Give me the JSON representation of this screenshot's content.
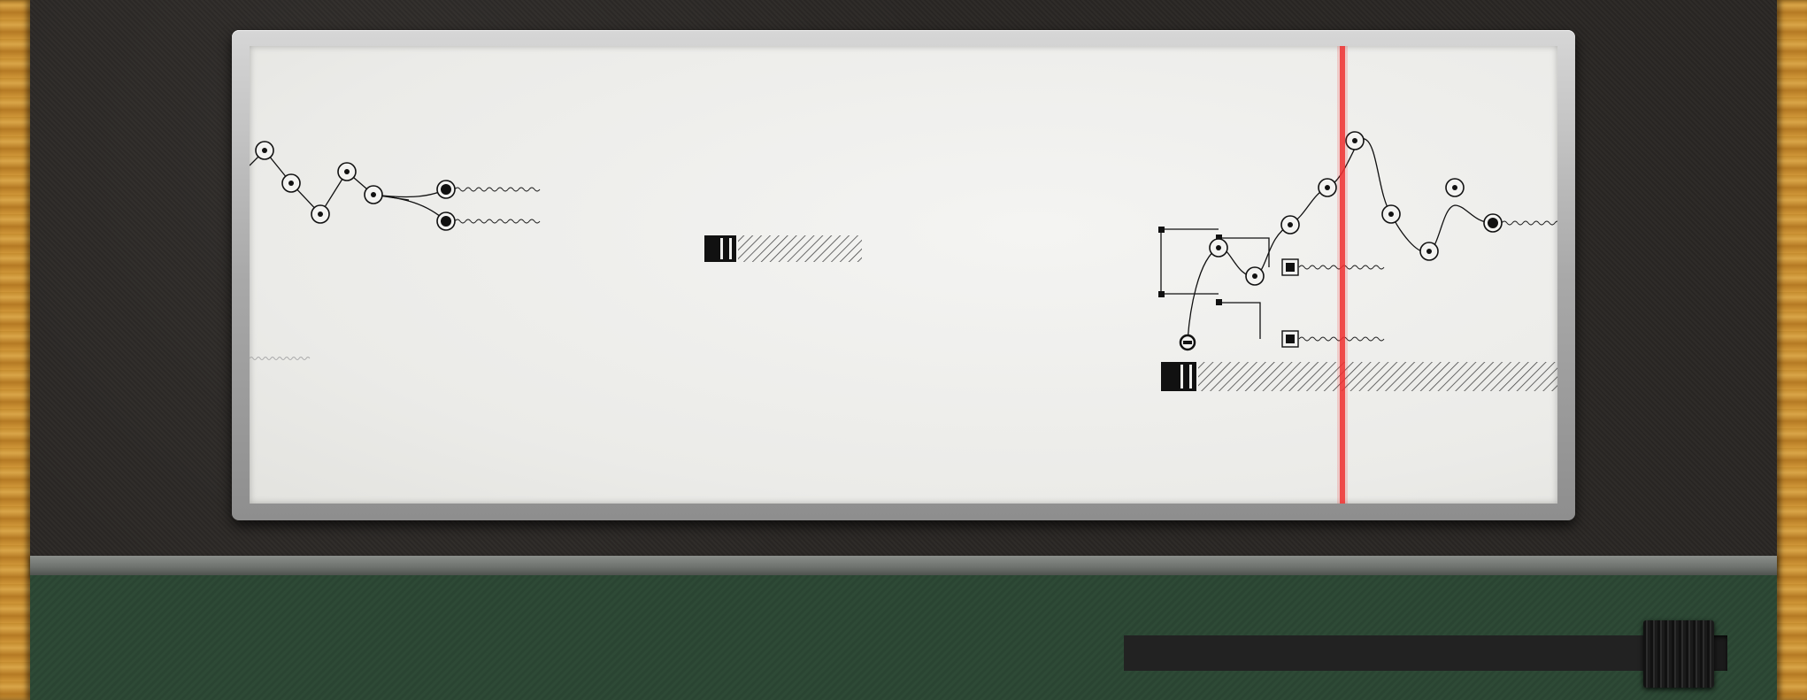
{
  "scene": "music-sequencer-level",
  "colors": {
    "playhead": "#ee3333",
    "ink": "#111111",
    "paper": "#efefec",
    "frame": "#b9b9b9",
    "board": "#2d4835",
    "wood": "#c9922f"
  },
  "icons": {
    "node": "circle-dot-icon",
    "node_filled": "filled-circle-icon",
    "square_node": "square-node-icon",
    "barcode": "barcode-block-icon",
    "handle": "slider-handle-icon"
  },
  "timeline": {
    "progress_percent": 92
  }
}
